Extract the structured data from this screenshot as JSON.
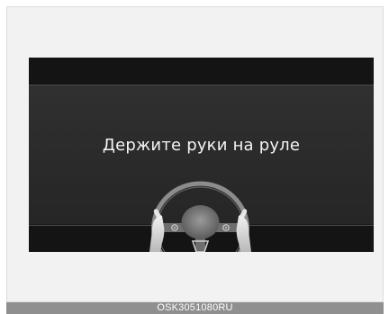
{
  "display": {
    "message": "Держите руки на руле"
  },
  "icons": {
    "wheel": "steering-wheel-with-hands-icon"
  },
  "caption": {
    "code": "OSK3051080RU"
  },
  "colors": {
    "screen_background": "#2c2c2c",
    "screen_bars": "#141414",
    "message_text": "#f4f4f4",
    "caption_bar": "#8f8f8f"
  }
}
